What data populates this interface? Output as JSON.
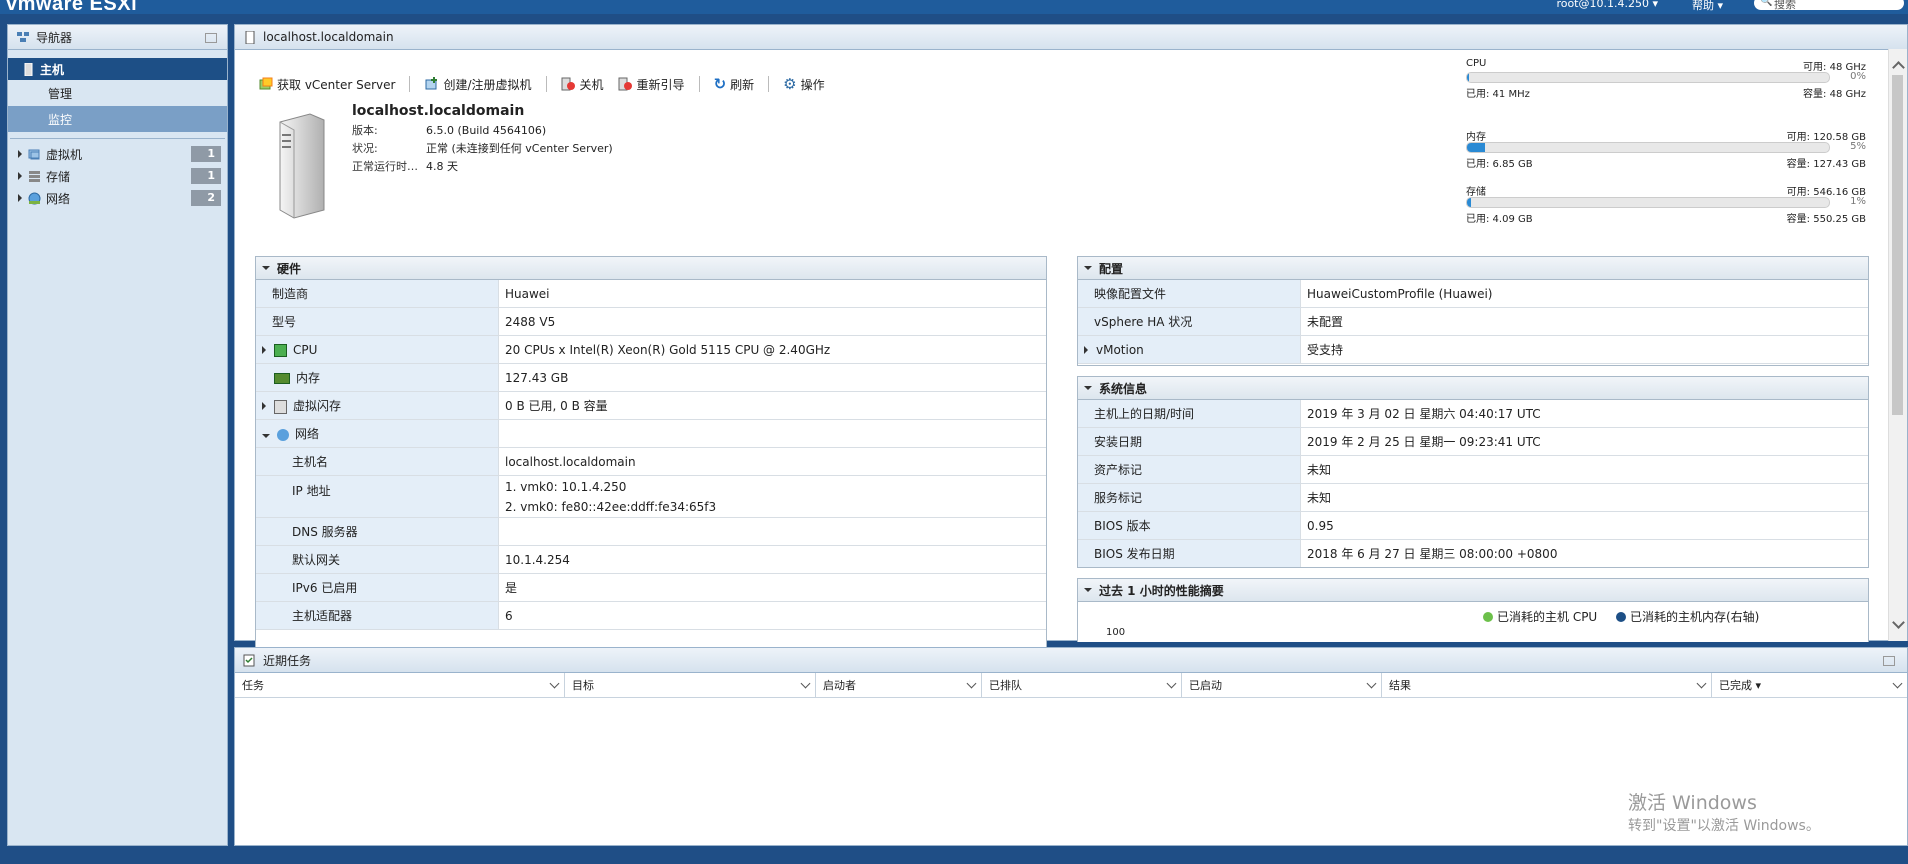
{
  "topbar": {
    "brand": "vmware ESXi",
    "user": "root@10.1.4.250 ▾",
    "help": "帮助 ▾",
    "search": "搜索"
  },
  "navigator": {
    "title": "导航器",
    "host": "主机",
    "manage": "管理",
    "monitor": "监控",
    "items": [
      {
        "label": "虚拟机",
        "count": "1"
      },
      {
        "label": "存储",
        "count": "1"
      },
      {
        "label": "网络",
        "count": "2"
      }
    ]
  },
  "main": {
    "title": "localhost.localdomain",
    "toolbar": [
      "获取 vCenter Server",
      "创建/注册虚拟机",
      "关机",
      "重新引导",
      "刷新",
      "操作"
    ],
    "host_name": "localhost.localdomain",
    "props": [
      {
        "k": "版本:",
        "v": "6.5.0 (Build 4564106)"
      },
      {
        "k": "状况:",
        "v": "正常 (未连接到任何 vCenter Server)"
      },
      {
        "k": "正常运行时…",
        "v": "4.8 天"
      }
    ],
    "resources": [
      {
        "name": "CPU",
        "free": "可用: 48 GHz",
        "used": "已用: 41 MHz",
        "cap": "容量: 48 GHz",
        "pct": "0%",
        "fill": 0.005
      },
      {
        "name": "内存",
        "free": "可用: 120.58 GB",
        "used": "已用: 6.85 GB",
        "cap": "容量: 127.43 GB",
        "pct": "5%",
        "fill": 0.05
      },
      {
        "name": "存储",
        "free": "可用: 546.16 GB",
        "used": "已用: 4.09 GB",
        "cap": "容量: 550.25 GB",
        "pct": "1%",
        "fill": 0.01
      }
    ]
  },
  "hardware": {
    "title": "硬件",
    "rows": [
      {
        "k": "制造商",
        "v": "Huawei"
      },
      {
        "k": "型号",
        "v": "2488 V5"
      },
      {
        "k": "CPU",
        "v": "20 CPUs x Intel(R) Xeon(R) Gold 5115 CPU @ 2.40GHz"
      },
      {
        "k": "内存",
        "v": "127.43 GB"
      },
      {
        "k": "虚拟闪存",
        "v": "0 B 已用, 0 B 容量"
      },
      {
        "k": "网络",
        "v": ""
      },
      {
        "k": "主机名",
        "v": "localhost.localdomain"
      },
      {
        "k": "IP 地址",
        "v": "1. vmk0: 10.1.4.250",
        "v2": "2. vmk0: fe80::42ee:ddff:fe34:65f3"
      },
      {
        "k": "DNS 服务器",
        "v": ""
      },
      {
        "k": "默认网关",
        "v": "10.1.4.254"
      },
      {
        "k": "IPv6 已启用",
        "v": "是"
      },
      {
        "k": "主机适配器",
        "v": "6"
      }
    ]
  },
  "config": {
    "title": "配置",
    "rows": [
      {
        "k": "映像配置文件",
        "v": "HuaweiCustomProfile (Huawei)"
      },
      {
        "k": "vSphere HA 状况",
        "v": "未配置"
      },
      {
        "k": "vMotion",
        "v": "受支持"
      }
    ]
  },
  "sysinfo": {
    "title": "系统信息",
    "rows": [
      {
        "k": "主机上的日期/时间",
        "v": "2019 年 3 月 02 日 星期六 04:40:17 UTC"
      },
      {
        "k": "安装日期",
        "v": "2019 年 2 月 25 日 星期一 09:23:41 UTC"
      },
      {
        "k": "资产标记",
        "v": "未知"
      },
      {
        "k": "服务标记",
        "v": "未知"
      },
      {
        "k": "BIOS 版本",
        "v": "0.95"
      },
      {
        "k": "BIOS 发布日期",
        "v": "2018 年 6 月 27 日 星期三 08:00:00 +0800"
      }
    ]
  },
  "perf": {
    "title": "过去 1 小时的性能摘要",
    "legend1": "已消耗的主机 CPU",
    "legend2": "已消耗的主机内存(右轴)",
    "axis": "100"
  },
  "tasks": {
    "title": "近期任务",
    "cols": [
      "任务",
      "目标",
      "启动者",
      "已排队",
      "已启动",
      "结果",
      "已完成 ▾"
    ]
  },
  "watermark": {
    "line1": "激活 Windows",
    "line2": "转到\"设置\"以激活 Windows。"
  },
  "colors": {
    "accent": "#1d4f86",
    "usage": "#2a8ad4"
  }
}
